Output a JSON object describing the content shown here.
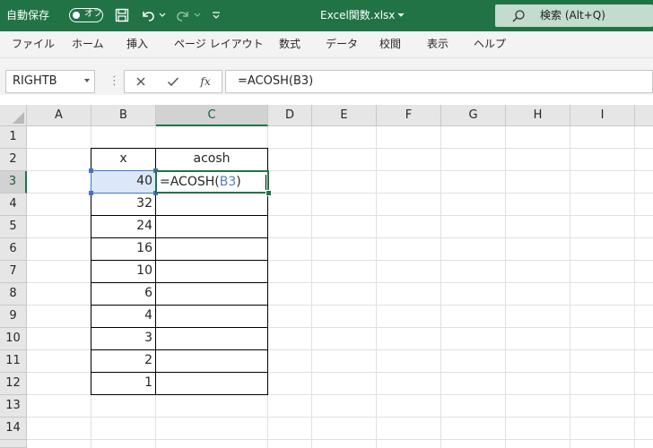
{
  "titlebar": {
    "autosave_label": "自動保存",
    "autosave_state": "オフ",
    "filename": "Excel関数.xlsx",
    "search_placeholder": "検索 (Alt+Q)"
  },
  "ribbon": {
    "tabs": [
      "ファイル",
      "ホーム",
      "挿入",
      "ページ レイアウト",
      "数式",
      "データ",
      "校閲",
      "表示",
      "ヘルプ"
    ]
  },
  "formula_bar": {
    "name_box": "RIGHTB",
    "formula": "=ACOSH(B3)"
  },
  "sheet": {
    "columns": [
      "A",
      "B",
      "C",
      "D",
      "E",
      "F",
      "G",
      "H",
      "I"
    ],
    "rows": [
      "1",
      "2",
      "3",
      "4",
      "5",
      "6",
      "7",
      "8",
      "9",
      "10",
      "11",
      "12",
      "13",
      "14"
    ],
    "table_header_x": "x",
    "table_header_acosh": "acosh",
    "x_values": [
      "40",
      "32",
      "24",
      "16",
      "10",
      "6",
      "4",
      "3",
      "2",
      "1"
    ],
    "edit_prefix": "=ACOSH(",
    "edit_ref": "B3",
    "edit_suffix": ")"
  },
  "colors": {
    "accent": "#217346",
    "reference": "#4472c4"
  }
}
